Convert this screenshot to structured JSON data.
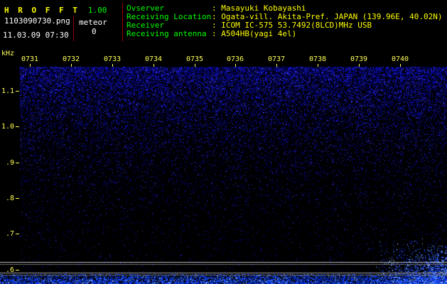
{
  "app": {
    "title": "H R O F F T",
    "version": "1.00",
    "filename": "1103090730.png",
    "meteor_label": "meteor",
    "meteor_count": "0",
    "datetime": "11.03.09 07:30"
  },
  "info": {
    "rows": [
      {
        "label": "Ovserver",
        "value": ": Masayuki Kobayashi"
      },
      {
        "label": "Receiving Location",
        "value": ": Ogata-vill. Akita-Pref. JAPAN (139.96E, 40.02N)"
      },
      {
        "label": "Receiver",
        "value": ": ICOM IC-575 53.7492(8LCD)MHz USB"
      },
      {
        "label": "Receiving antenna",
        "value": ": A504HB(yagi 4el)"
      }
    ]
  },
  "spectrogram": {
    "unit": "kHz",
    "time_labels": [
      "0731",
      "0732",
      "0733",
      "0734",
      "0735",
      "0736",
      "0737",
      "0738",
      "0739",
      "0740"
    ],
    "freq_labels": [
      "1.1",
      "1.0",
      ".9",
      ".8",
      ".7",
      ".6"
    ],
    "carrier_lines_khz": [
      0.62,
      0.59
    ],
    "event_note": "bright echo burst bottom-right near 0739-0740 at ~0.6 kHz"
  },
  "colors": {
    "background": "#000000",
    "title_yellow": "#ffff00",
    "version_green": "#00ff00",
    "label_green": "#00ff00",
    "value_yellow": "#ffff00",
    "text_white": "#ffffff",
    "axis_yellow": "#ffff55",
    "separator_red": "#990000",
    "noise_blue_dim": "#000080",
    "noise_blue_mid": "#1212c0",
    "noise_blue_bright": "#4040ff",
    "echo_blue": "#4080ff",
    "carrier_gray": "#bebebe"
  }
}
